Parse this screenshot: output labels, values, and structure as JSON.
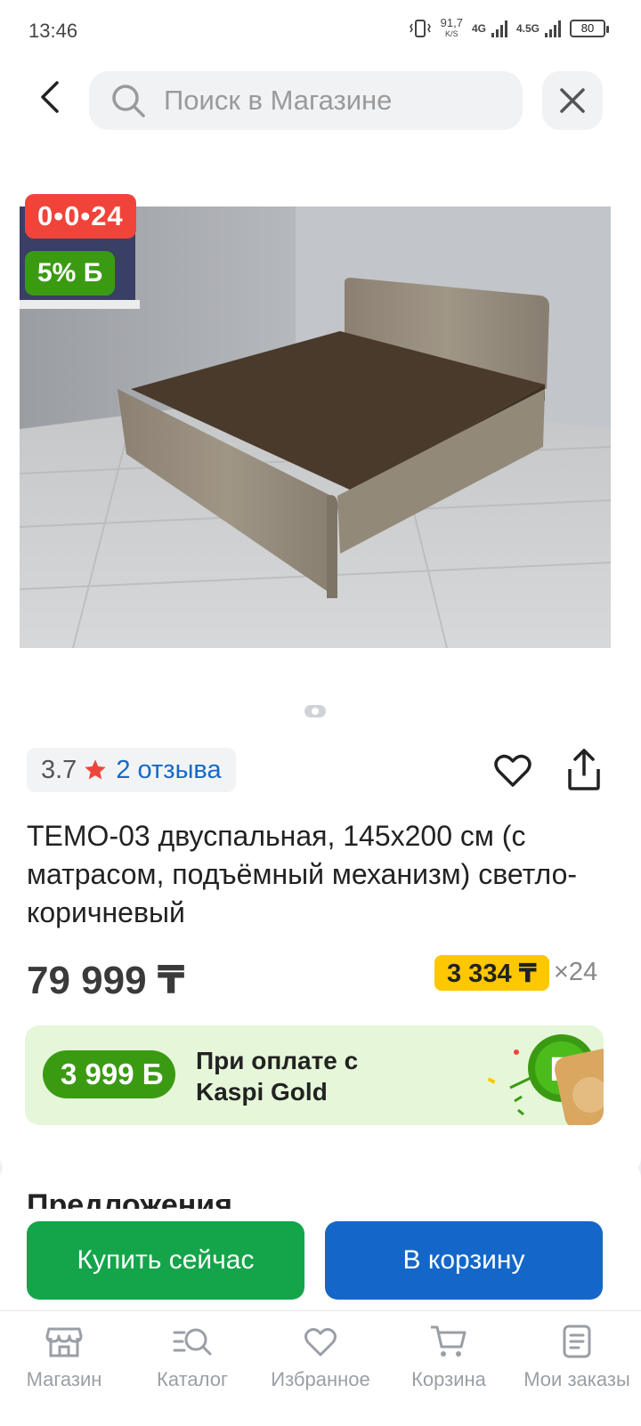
{
  "status_bar": {
    "time": "13:46",
    "speed_value": "91,7",
    "speed_unit": "K/S",
    "net1": "4G",
    "net2": "4.5G",
    "battery": "80"
  },
  "header": {
    "search_placeholder": "Поиск в Магазине"
  },
  "product": {
    "timer_badge": "0•0•24",
    "bonus_badge": "5% Б",
    "rating": "3.7",
    "reviews": "2 отзыва",
    "title": "ТЕМО-03 двуспальная, 145x200 см (с матрасом, подъёмный механизм) светло-коричневый",
    "price": "79 999 ₸",
    "installment_amount": "3 334 ₸",
    "installment_months": "×24"
  },
  "gold_banner": {
    "bonus": "3 999 Б",
    "line1": "При оплате с",
    "line2": "Kaspi Gold"
  },
  "offers": {
    "title": "Предложения"
  },
  "actions": {
    "buy_now": "Купить сейчас",
    "add_to_cart": "В корзину"
  },
  "bottom_nav": {
    "shop": "Магазин",
    "catalog": "Каталог",
    "favorites": "Избранное",
    "cart": "Корзина",
    "orders": "Мои заказы"
  },
  "colors": {
    "timer_red": "#f0443a",
    "bonus_green": "#3a9b13",
    "installment_yellow": "#fec700",
    "buy_green": "#14a54a",
    "cart_blue": "#1467c9",
    "link_blue": "#1569c7"
  }
}
